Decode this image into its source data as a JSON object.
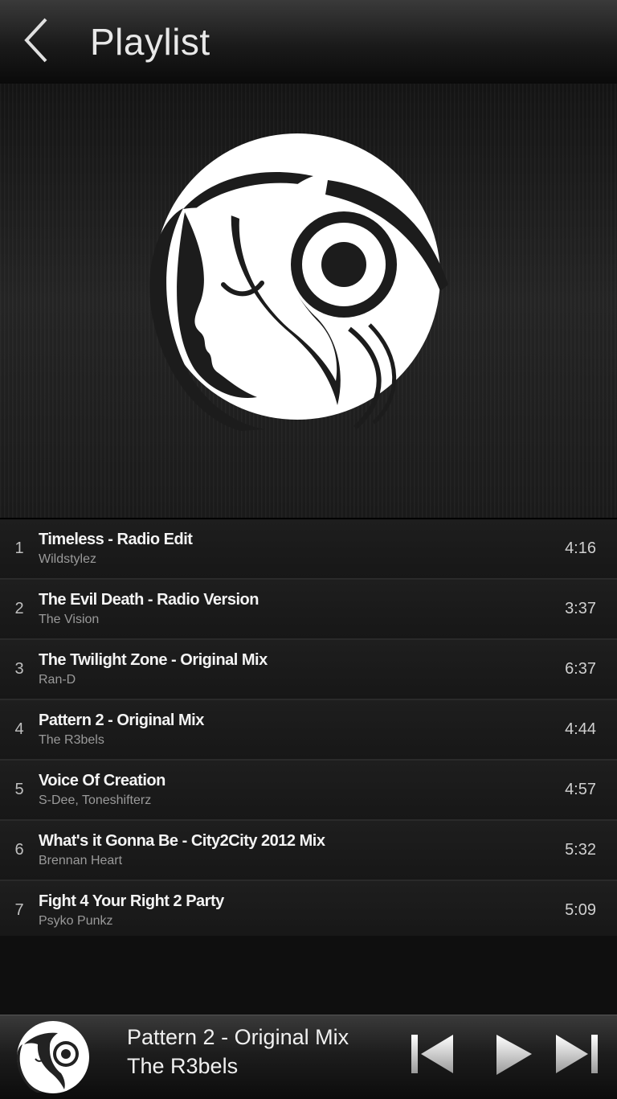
{
  "header": {
    "title": "Playlist",
    "back_icon": "chevron-left-icon"
  },
  "artwork": {
    "icon": "headphones-girl-logo"
  },
  "tracks": [
    {
      "num": "1",
      "title": "Timeless - Radio Edit",
      "artist": "Wildstylez",
      "duration": "4:16"
    },
    {
      "num": "2",
      "title": "The Evil Death - Radio Version",
      "artist": "The Vision",
      "duration": "3:37"
    },
    {
      "num": "3",
      "title": "The Twilight Zone - Original Mix",
      "artist": "Ran-D",
      "duration": "6:37"
    },
    {
      "num": "4",
      "title": "Pattern 2 - Original Mix",
      "artist": "The R3bels",
      "duration": "4:44"
    },
    {
      "num": "5",
      "title": "Voice Of Creation",
      "artist": "S-Dee, Toneshifterz",
      "duration": "4:57"
    },
    {
      "num": "6",
      "title": "What's it Gonna Be - City2City 2012 Mix",
      "artist": "Brennan Heart",
      "duration": "5:32"
    },
    {
      "num": "7",
      "title": "Fight 4 Your Right 2 Party",
      "artist": "Psyko Punkz",
      "duration": "5:09"
    }
  ],
  "now_playing": {
    "title": "Pattern 2 - Original Mix",
    "artist": "The R3bels",
    "controls": [
      "skip-previous-icon",
      "play-icon",
      "skip-next-icon"
    ]
  },
  "colors": {
    "background": "#0e0e0e",
    "list_bg": "#1a1a1a",
    "text": "#ffffff",
    "subtext": "#9a9a9a"
  }
}
